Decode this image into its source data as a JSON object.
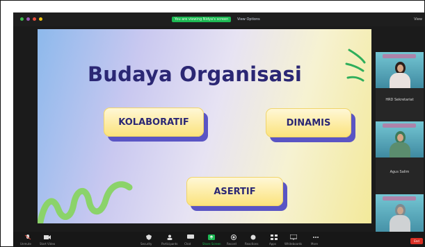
{
  "window": {
    "share_badge": "You are viewing Nidya's screen",
    "view_label": "View Options",
    "top_right": "View"
  },
  "slide": {
    "title": "Budaya Organisasi",
    "cards": [
      {
        "label": "KOLABORATIF"
      },
      {
        "label": "DINAMIS"
      },
      {
        "label": "ASERTIF"
      }
    ],
    "colors": {
      "title": "#2b2774",
      "card_face": "#fbe27a",
      "card_shadow": "#5a55c4",
      "squiggle": "#8bd36a",
      "leaf": "#2fae5b"
    }
  },
  "participants": [
    {
      "name": "",
      "caption": ""
    },
    {
      "name": "HRD Sekretariat",
      "caption": "HRD Sekretariat"
    },
    {
      "name": "",
      "caption": "Agus Salim"
    },
    {
      "name": "",
      "caption": ""
    }
  ],
  "toolbar": {
    "items": [
      {
        "icon": "mic-icon",
        "label": "Unmute"
      },
      {
        "icon": "video-icon",
        "label": "Start Video"
      },
      {
        "icon": "security-icon",
        "label": "Security"
      },
      {
        "icon": "participants-icon",
        "label": "Participants"
      },
      {
        "icon": "chat-icon",
        "label": "Chat"
      },
      {
        "icon": "share-screen-icon",
        "label": "Share Screen"
      },
      {
        "icon": "record-icon",
        "label": "Record"
      },
      {
        "icon": "reactions-icon",
        "label": "Reactions"
      },
      {
        "icon": "apps-icon",
        "label": "Apps"
      },
      {
        "icon": "whiteboard-icon",
        "label": "Whiteboards"
      },
      {
        "icon": "more-icon",
        "label": "More"
      }
    ],
    "end_label": "End"
  }
}
